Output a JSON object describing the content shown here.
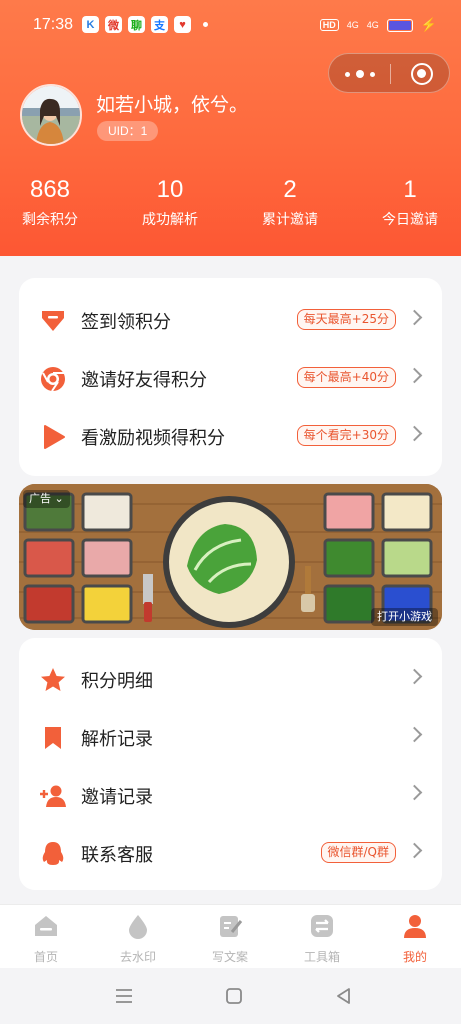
{
  "status_bar": {
    "time": "17:38",
    "apps": [
      "K",
      "微",
      "聊",
      "支",
      "♥"
    ],
    "hd": "HD",
    "signal1": "4G",
    "signal2": "4G"
  },
  "profile": {
    "username": "如若小城，依兮。",
    "uid": "UID：1"
  },
  "stats": [
    {
      "value": "868",
      "label": "剩余积分"
    },
    {
      "value": "10",
      "label": "成功解析"
    },
    {
      "value": "2",
      "label": "累计邀请"
    },
    {
      "value": "1",
      "label": "今日邀请"
    }
  ],
  "earn_menu": [
    {
      "icon": "gift-icon",
      "label": "签到领积分",
      "badge": "每天最高+25分"
    },
    {
      "icon": "chrome-icon",
      "label": "邀请好友得积分",
      "badge": "每个最高+40分"
    },
    {
      "icon": "play-icon",
      "label": "看激励视频得积分",
      "badge": "每个看完+30分"
    }
  ],
  "ad": {
    "tag": "广告 ⌄",
    "cta": "打开小游戏"
  },
  "records_menu": [
    {
      "icon": "star-icon",
      "label": "积分明细",
      "badge": ""
    },
    {
      "icon": "bookmark-icon",
      "label": "解析记录",
      "badge": ""
    },
    {
      "icon": "add-user-icon",
      "label": "邀请记录",
      "badge": ""
    },
    {
      "icon": "qq-icon",
      "label": "联系客服",
      "badge": "微信群/Q群"
    }
  ],
  "tabbar": [
    {
      "icon": "home-icon",
      "label": "首页",
      "active": false
    },
    {
      "icon": "drop-icon",
      "label": "去水印",
      "active": false
    },
    {
      "icon": "edit-icon",
      "label": "写文案",
      "active": false
    },
    {
      "icon": "toolbox-icon",
      "label": "工具箱",
      "active": false
    },
    {
      "icon": "user-icon",
      "label": "我的",
      "active": true
    }
  ],
  "colors": {
    "accent": "#f2603a",
    "header_top": "#fe7a4a",
    "header_bottom": "#fd5733",
    "inactive_tab": "#b5b5b5"
  }
}
